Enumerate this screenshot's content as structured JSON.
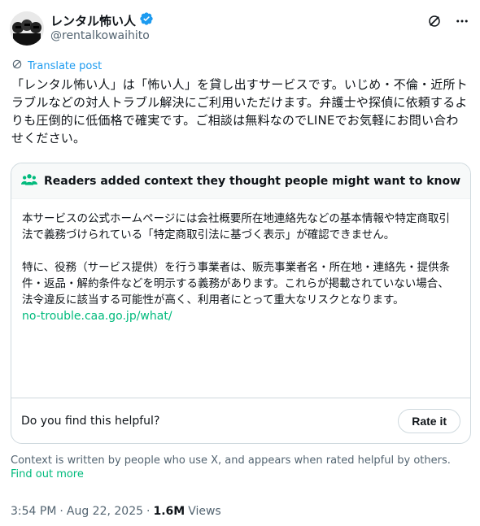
{
  "author": {
    "display_name": "レンタル怖い人",
    "handle": "@rentalkowaihito"
  },
  "icons": {
    "verified": "verified-badge-icon",
    "grok": "grok-icon",
    "more": "more-icon",
    "translate": "translate-icon",
    "people": "people-icon"
  },
  "colors": {
    "accent_blue": "#1d9bf0",
    "note_green": "#00ba7c",
    "muted_gray": "#536471",
    "text_primary": "#0f1419"
  },
  "post": {
    "translate_label": "Translate post",
    "text": "「レンタル怖い人」は「怖い人」を貸し出すサービスです。いじめ・不倫・近所トラブルなどの対人トラブル解決にご利用いただけます。弁護士や探偵に依頼するよりも圧倒的に低価格で確実です。ご相談は無料なのでLINEでお気軽にお問い合わせください。"
  },
  "community_note": {
    "header": "Readers added context they thought people might want to know",
    "paragraph1": "本サービスの公式ホームページには会社概要所在地連絡先などの基本情報や特定商取引法で義務づけられている「特定商取引法に基づく表示」が確認できません。",
    "paragraph2": "特に、役務（サービス提供）を行う事業者は、販売事業者名・所在地・連絡先・提供条件・返品・解約条件などを明示する義務があります。これらが掲載されていない場合、法令違反に該当する可能性が高く、利用者にとって重大なリスクとなります。",
    "link": "no-trouble.caa.go.jp/what/",
    "helpful_question": "Do you find this helpful?",
    "rate_button": "Rate it"
  },
  "context_footer": {
    "text": "Context is written by people who use X, and appears when rated helpful by others.",
    "link": "Find out more"
  },
  "meta": {
    "time": "3:54 PM",
    "date": "Aug 22, 2025",
    "views_count": "1.6M",
    "views_label": "Views"
  }
}
